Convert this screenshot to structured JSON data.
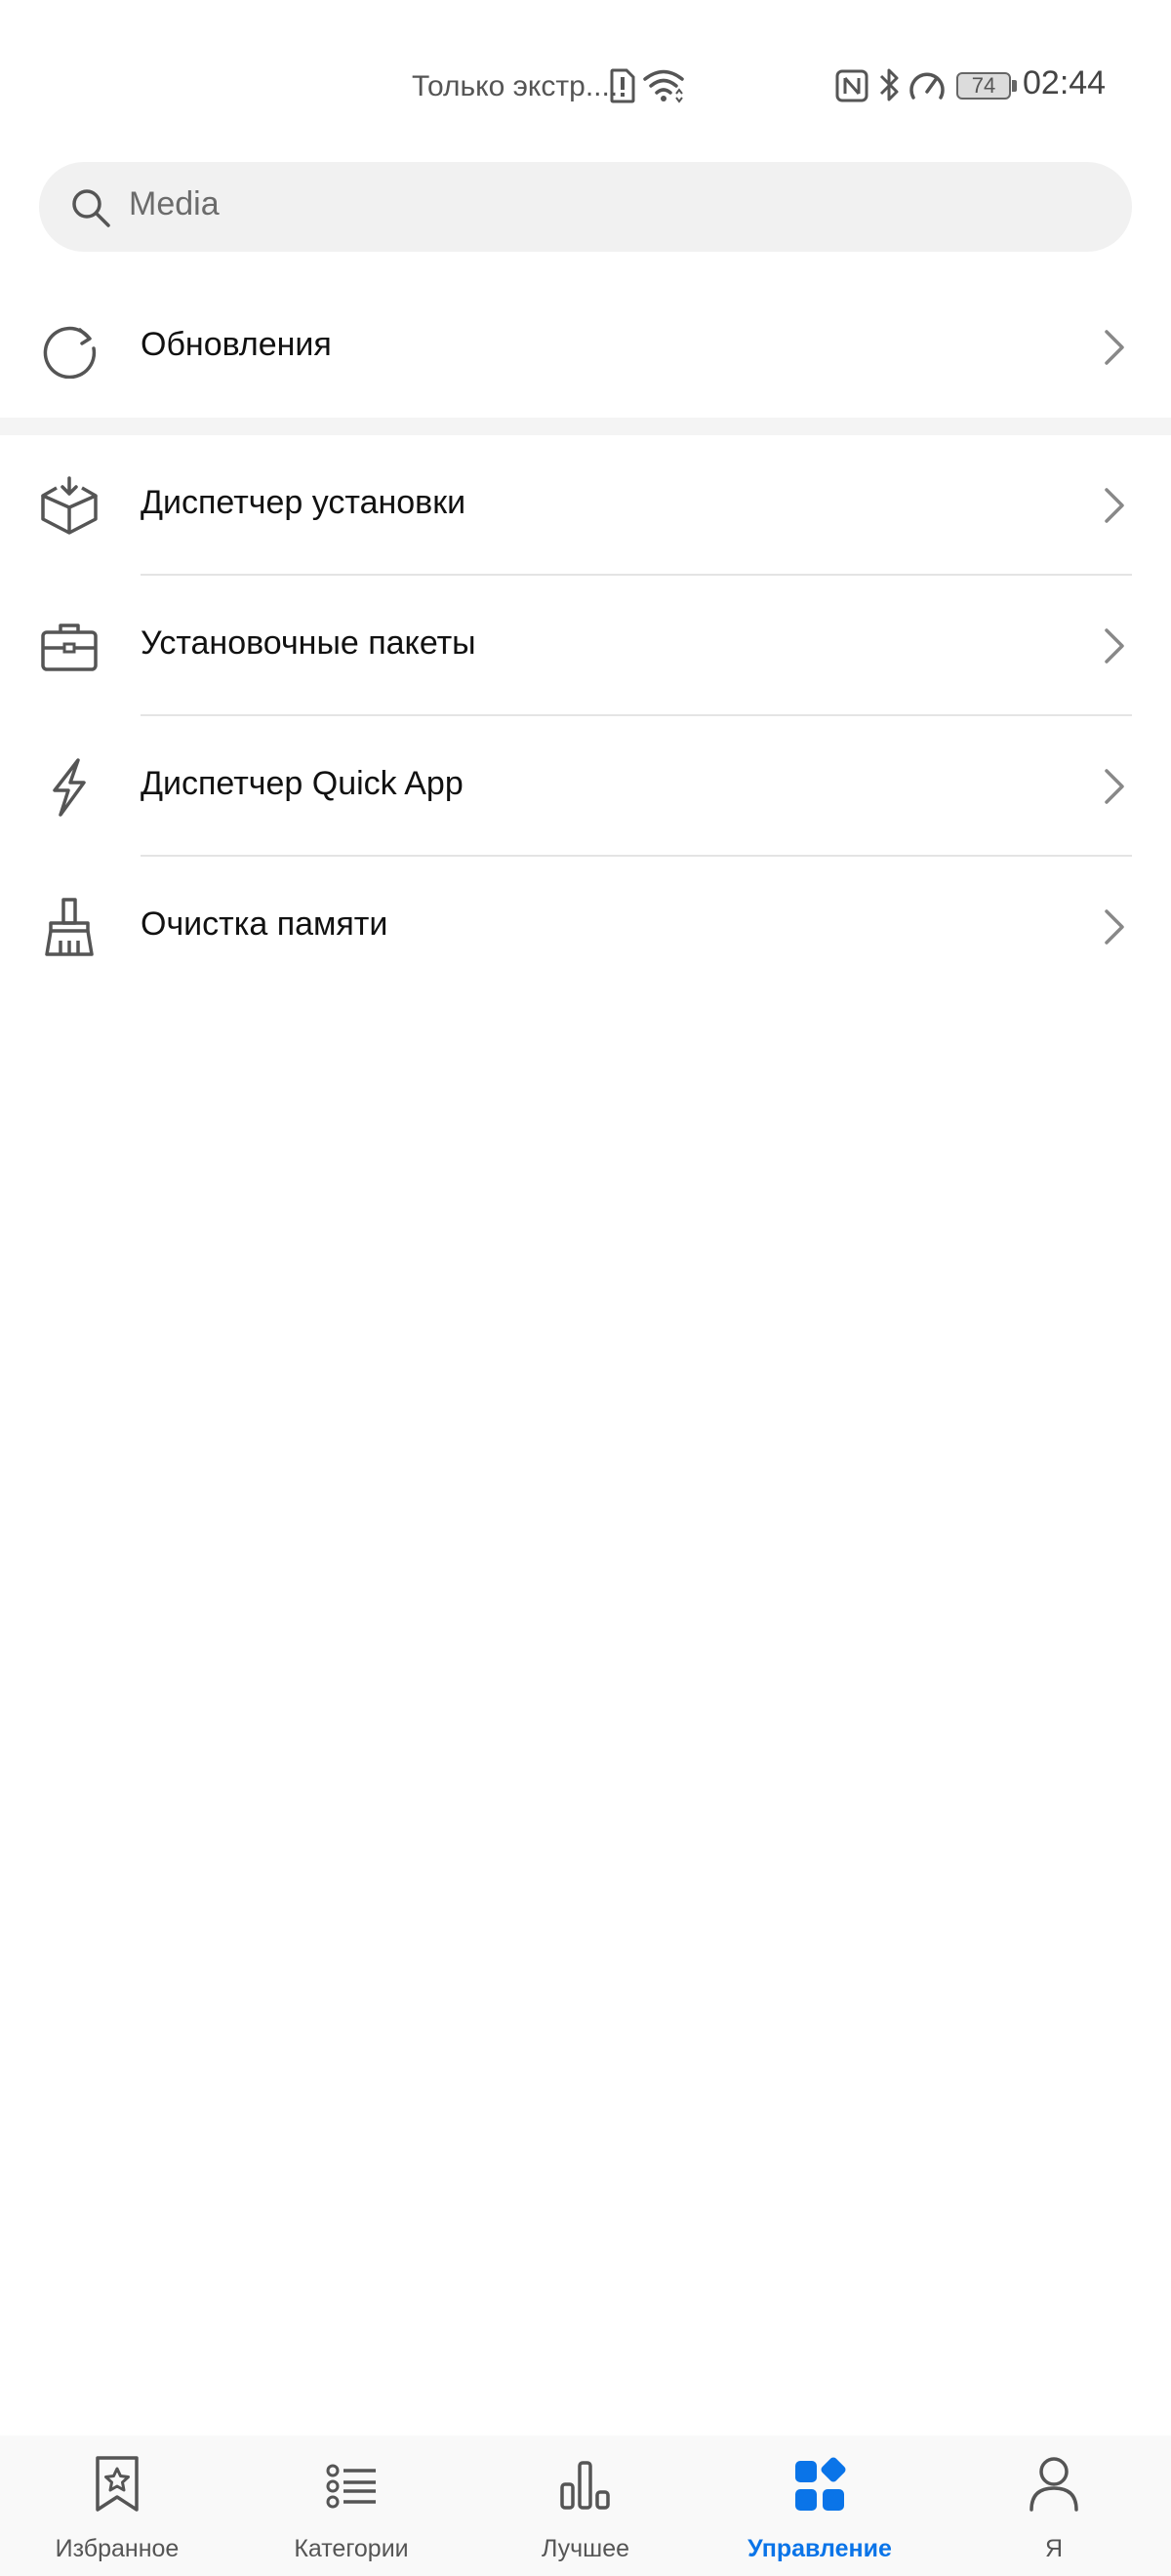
{
  "status_bar": {
    "carrier_text": "Только экстр....",
    "battery_level": "74",
    "time": "02:44"
  },
  "search": {
    "text": "Media"
  },
  "menu": {
    "updates": {
      "label": "Обновления",
      "icon": "refresh-icon"
    },
    "items": [
      {
        "label": "Диспетчер установки",
        "icon": "box-download-icon"
      },
      {
        "label": "Установочные пакеты",
        "icon": "briefcase-icon"
      },
      {
        "label": "Диспетчер Quick App",
        "icon": "lightning-icon"
      },
      {
        "label": "Очистка памяти",
        "icon": "broom-icon"
      }
    ]
  },
  "bottom_nav": {
    "active_color": "#0a74e8",
    "items": [
      {
        "label": "Избранное",
        "icon": "star-bookmark-icon"
      },
      {
        "label": "Категории",
        "icon": "list-icon"
      },
      {
        "label": "Лучшее",
        "icon": "bar-chart-icon"
      },
      {
        "label": "Управление",
        "icon": "apps-grid-icon",
        "active": true
      },
      {
        "label": "Я",
        "icon": "person-icon"
      }
    ]
  }
}
